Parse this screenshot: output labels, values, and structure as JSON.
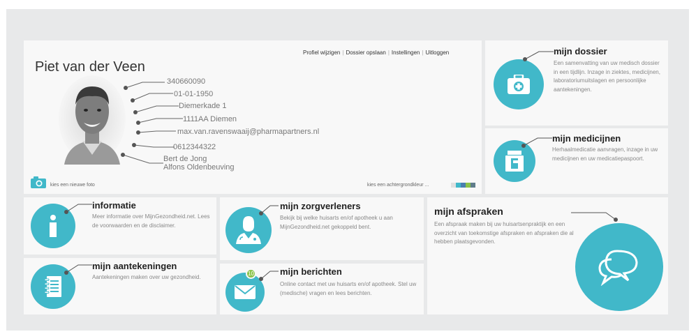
{
  "profile": {
    "name": "Piet van der Veen",
    "nav": [
      "Profiel wijzigen",
      "Dossier opslaan",
      "Instellingen",
      "Uitloggen"
    ],
    "fields": {
      "bsn": "340660090",
      "birthdate": "01-01-1950",
      "street": "Diemerkade 1",
      "postal": "1111AA Diemen",
      "email": "max.van.ravenswaaij@pharmapartners.nl",
      "phone": "0612344322",
      "doctor1": "Bert de Jong",
      "doctor2": "Alfons Oldenbeuving"
    },
    "new_photo_label": "kies een nieuwe foto",
    "background_label": "kies een achtergrondkleur ...",
    "swatches": [
      "#e0e0e0",
      "#41b8c9",
      "#4a7fb0",
      "#8bc34a",
      "#607d8b"
    ]
  },
  "tiles": {
    "dossier": {
      "title": "mijn dossier",
      "desc": "Een samenvatting van uw medisch dossier in een tijdlijn. Inzage in ziektes, medicijnen, laboratoriumuitslagen en persoonlijke aantekeningen."
    },
    "medicijnen": {
      "title": "mijn medicijnen",
      "desc": "Herhaalmedicatie aanvragen, inzage in uw medicijnen en uw medicatiepaspoort."
    },
    "informatie": {
      "title": "informatie",
      "desc": "Meer informatie over MijnGezondheid.net. Lees de voorwaarden en de disclaimer."
    },
    "zorgverleners": {
      "title": "mijn zorgverleners",
      "desc": "Bekijk bij welke huisarts en/of apotheek u aan MijnGezondheid.net gekoppeld bent."
    },
    "afspraken": {
      "title": "mijn afspraken",
      "desc": "Een afspraak maken bij uw huisartsenpraktijk en een overzicht van toekomstige afspraken en afspraken die al hebben plaatsgevonden."
    },
    "aantekeningen": {
      "title": "mijn aantekeningen",
      "desc": "Aantekeningen maken over uw gezondheid."
    },
    "berichten": {
      "title": "mijn berichten",
      "desc": "Online contact met uw huisarts en/of apotheek. Stel uw (medische) vragen en lees berichten.",
      "badge": "10"
    }
  },
  "colors": {
    "accent": "#41b8c9",
    "badge": "#8bc34a",
    "connector": "#555555"
  }
}
